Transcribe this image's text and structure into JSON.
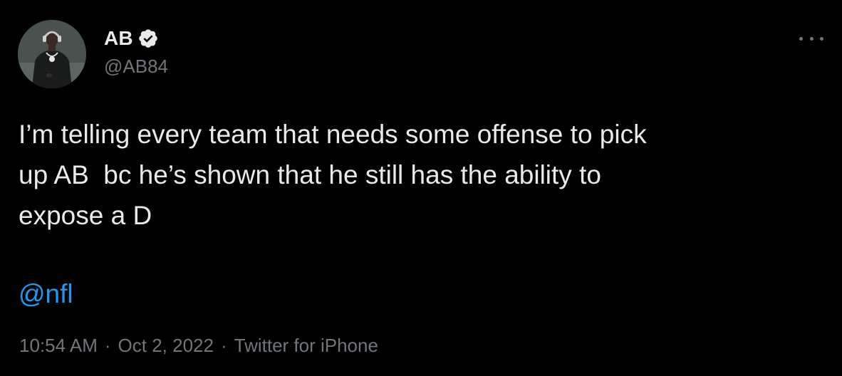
{
  "author": {
    "display_name": "AB",
    "handle": "@AB84",
    "verified": true,
    "verified_color": "#1d9bf0",
    "avatar_icon": "profile-photo"
  },
  "tweet": {
    "text": "I’m telling every team that needs some offense to pick\nup AB  bc he’s shown that he still has the ability to\nexpose a D",
    "mention": "@nfl",
    "mention_color": "#1d9bf0"
  },
  "meta": {
    "time": "10:54 AM",
    "separator": "·",
    "date": "Oct 2, 2022",
    "source": "Twitter for iPhone"
  },
  "more_icon": "more-horizontal-icon",
  "theme": {
    "background": "#000000",
    "text": "#e7e9ea",
    "secondary_text": "#71767b"
  }
}
